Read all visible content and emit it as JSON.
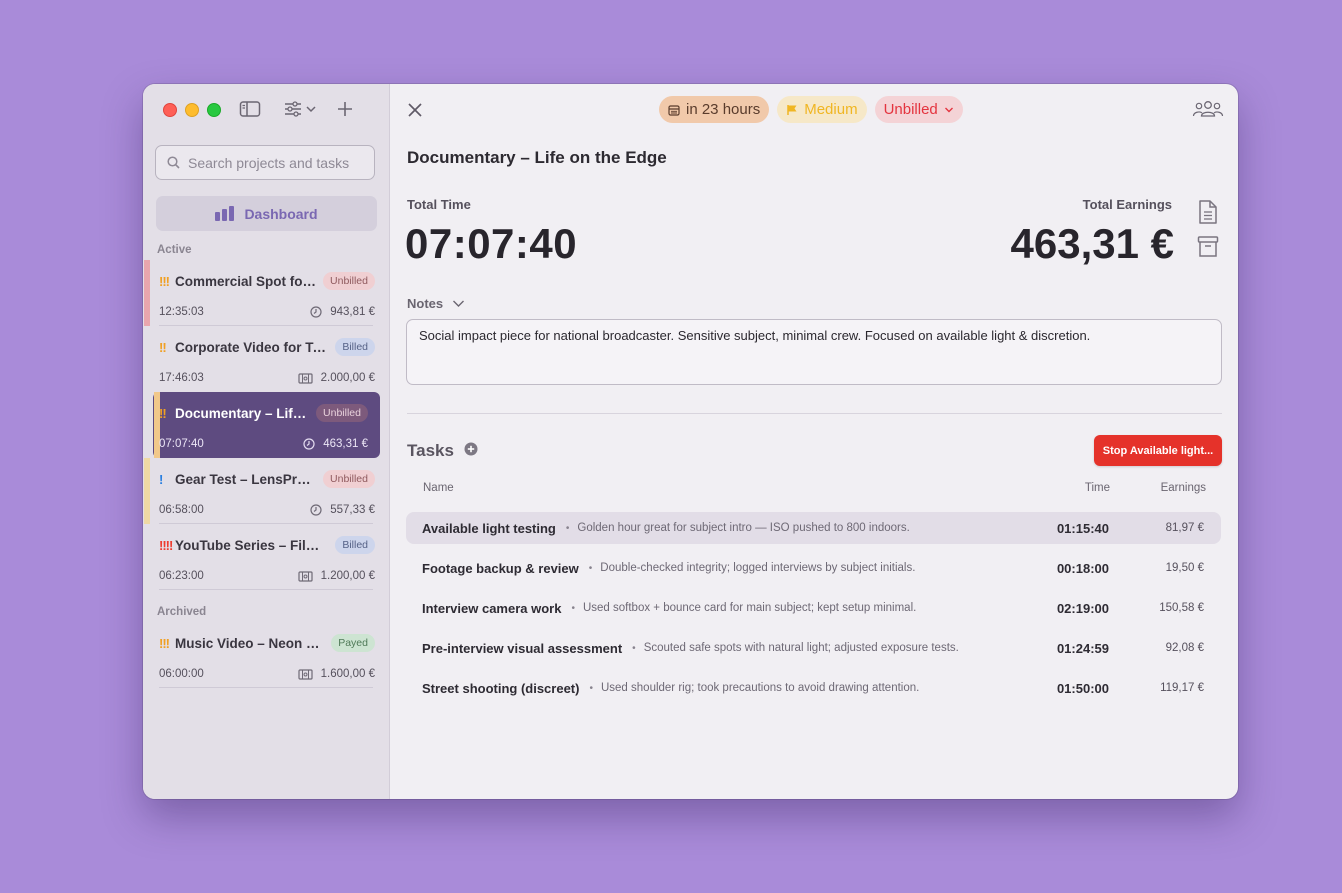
{
  "window": {
    "sidebar": {
      "search_placeholder": "Search projects and tasks",
      "dashboard_label": "Dashboard",
      "active_label": "Active",
      "archived_label": "Archived",
      "projects": [
        {
          "priority": "!!!",
          "priority_color": "#f0a024",
          "stripe": "#e9a6ad",
          "name": "Commercial Spot for Local Coffee Brand",
          "status": "Unbilled",
          "time": "12:35:03",
          "rate_icon": "clock-icon",
          "amount": "943,81 €"
        },
        {
          "priority": "!!",
          "priority_color": "#f0a024",
          "stripe": "",
          "name": "Corporate Video for Tech Startup",
          "status": "Billed",
          "time": "17:46:03",
          "rate_icon": "banknote-icon",
          "amount": "2.000,00 €"
        },
        {
          "priority": "!!",
          "priority_color": "#f0a024",
          "stripe": "#f1c88a",
          "name": "Documentary – Life on the Edge",
          "status": "Unbilled",
          "time": "07:07:40",
          "rate_icon": "clock-icon",
          "amount": "463,31 €"
        },
        {
          "priority": "!",
          "priority_color": "#2a7fe0",
          "stripe": "#efd9a4",
          "name": "Gear Test – LensPro Review",
          "status": "Unbilled",
          "time": "06:58:00",
          "rate_icon": "clock-icon",
          "amount": "557,33 €"
        },
        {
          "priority": "!!!!",
          "priority_color": "#ee3c2f",
          "stripe": "",
          "name": "YouTube Series – Filmmaking Tips",
          "status": "Billed",
          "time": "06:23:00",
          "rate_icon": "banknote-icon",
          "amount": "1.200,00 €"
        }
      ],
      "archived": [
        {
          "priority": "!!!",
          "priority_color": "#f0a024",
          "name": "Music Video – Neon Nights",
          "status": "Payed",
          "time": "06:00:00",
          "rate_icon": "banknote-icon",
          "amount": "1.600,00 €"
        }
      ]
    },
    "header": {
      "due_chip": "in 23 hours",
      "priority_chip": "Medium",
      "billing_chip": "Unbilled"
    },
    "project": {
      "title": "Documentary – Life on the Edge",
      "total_time_label": "Total Time",
      "total_time": "07:07:40",
      "total_earnings_label": "Total Earnings",
      "total_earnings": "463,31 €",
      "notes_label": "Notes",
      "notes": "Social impact piece for national broadcaster. Sensitive subject, minimal crew. Focused on available light & discretion."
    },
    "tasks": {
      "label": "Tasks",
      "stop_button": "Stop Available light...",
      "columns": {
        "name": "Name",
        "time": "Time",
        "earnings": "Earnings"
      },
      "rows": [
        {
          "name": "Available light testing",
          "note": "Golden hour great for subject intro — ISO pushed to 800 indoors.",
          "time": "01:15:40",
          "earnings": "81,97 €"
        },
        {
          "name": "Footage backup & review",
          "note": "Double-checked integrity; logged interviews by subject initials.",
          "time": "00:18:00",
          "earnings": "19,50 €"
        },
        {
          "name": "Interview camera work",
          "note": "Used softbox + bounce card for main subject; kept setup minimal.",
          "time": "02:19:00",
          "earnings": "150,58 €"
        },
        {
          "name": "Pre-interview visual assessment",
          "note": "Scouted safe spots with natural light; adjusted exposure tests.",
          "time": "01:24:59",
          "earnings": "92,08 €"
        },
        {
          "name": "Street shooting (discreet)",
          "note": "Used shoulder rig; took precautions to avoid drawing attention.",
          "time": "01:50:00",
          "earnings": "119,17 €"
        }
      ]
    }
  }
}
